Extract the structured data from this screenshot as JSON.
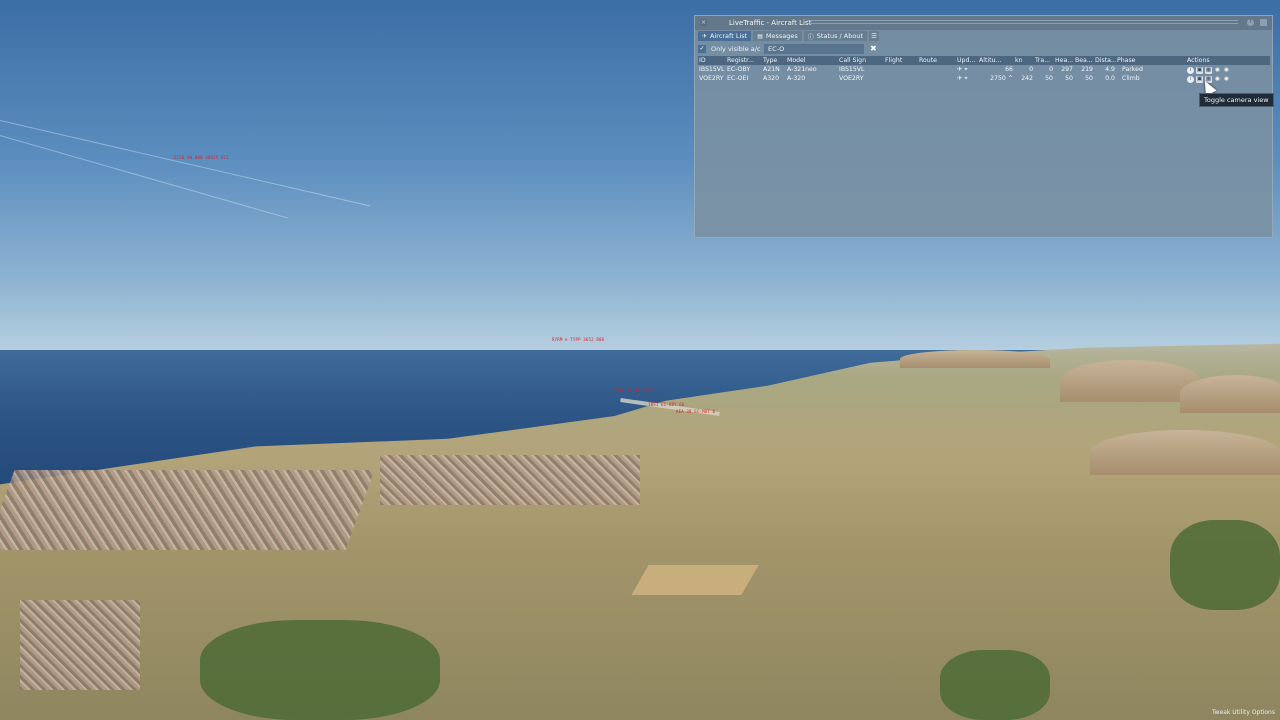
{
  "window": {
    "title": "LiveTraffic - Aircraft List",
    "help_icon": "help-icon",
    "tabs": [
      {
        "label": "Aircraft List",
        "icon": "plane-icon",
        "active": true
      },
      {
        "label": "Messages",
        "icon": "document-icon",
        "active": false
      },
      {
        "label": "Status / About",
        "icon": "info-icon",
        "active": false
      }
    ],
    "filter": {
      "checkbox_label": "Only visible a/c",
      "checked": true,
      "search_value": "EC-O",
      "clear_symbol": "✖"
    },
    "columns": [
      "ID",
      "Registr...",
      "Type",
      "Model",
      "Call Sign",
      "Flight",
      "Route",
      "Upd...",
      "Altitu...",
      "kn",
      "Tra...",
      "Hea...",
      "Bea...",
      "Dista...",
      "Phase",
      "Actions"
    ],
    "rows": [
      {
        "id": "IBS15VL",
        "reg": "EC-OBY",
        "type": "A21N",
        "model": "A-321neo",
        "callsign": "IBS15VL",
        "flight": "",
        "route": "",
        "alt": "66",
        "vsi": "",
        "kn": "0",
        "trk": "0",
        "hdg": "297",
        "brg": "219",
        "dist": "4.9",
        "phase": "Parked"
      },
      {
        "id": "VOE2RY",
        "reg": "EC-OEI",
        "type": "A320",
        "model": "A-320",
        "callsign": "VOE2RY",
        "flight": "",
        "route": "",
        "alt": "2750",
        "vsi": "^",
        "kn": "242",
        "trk": "50",
        "hdg": "50",
        "brg": "50",
        "dist": "0.0",
        "phase": "Climb"
      }
    ]
  },
  "tooltip": "Toggle camera view",
  "footer_hint": "Tweak Utility Options",
  "scene_labels": [
    "ECS6 VH 888 38925 ECI",
    "RYRM e TYPP 3652 888",
    "VOE2 EC-OEI 242",
    "IBS1 EC-OBY 66",
    "AEA 3B EC-MUT 0"
  ]
}
